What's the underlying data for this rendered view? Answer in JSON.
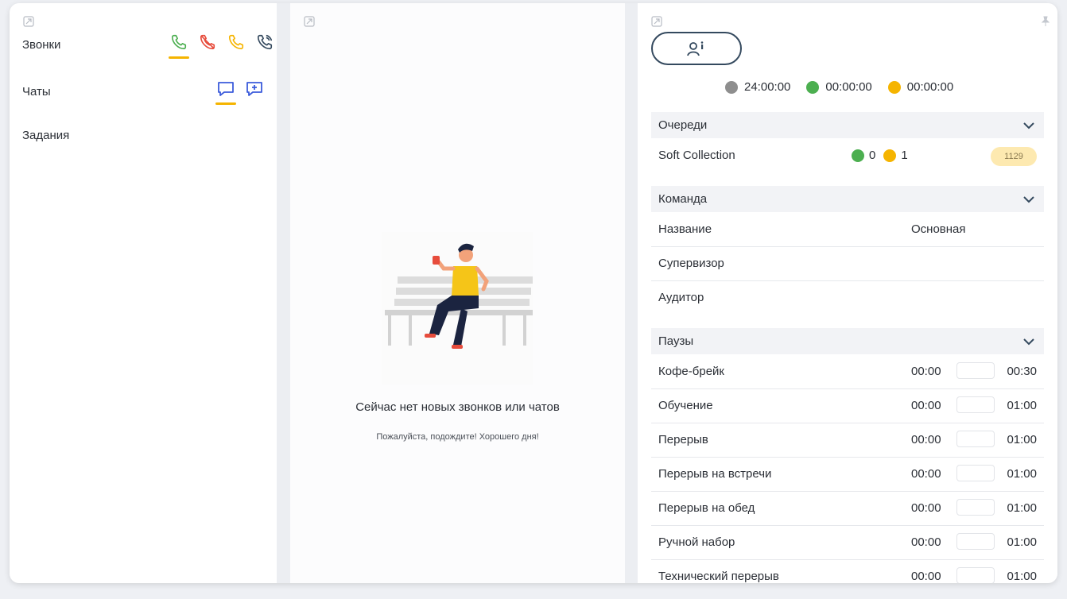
{
  "left": {
    "calls_label": "Звонки",
    "chats_label": "Чаты",
    "tasks_label": "Задания"
  },
  "middle": {
    "empty_title": "Сейчас нет новых звонков или чатов",
    "empty_subtitle": "Пожалуйста, подождите! Хорошего дня!"
  },
  "right": {
    "timers": [
      {
        "color": "#8e8e8e",
        "value": "24:00:00"
      },
      {
        "color": "#4caf50",
        "value": "00:00:00"
      },
      {
        "color": "#f5b400",
        "value": "00:00:00"
      }
    ],
    "queues": {
      "title": "Очереди",
      "items": [
        {
          "name": "Soft Collection",
          "green": "0",
          "yellow": "1",
          "badge": "1129"
        }
      ]
    },
    "team": {
      "title": "Команда",
      "rows": [
        {
          "label": "Название",
          "value": "Основная"
        },
        {
          "label": "Супервизор",
          "value": ""
        },
        {
          "label": "Аудитор",
          "value": ""
        }
      ]
    },
    "pauses": {
      "title": "Паузы",
      "items": [
        {
          "name": "Кофе-брейк",
          "start": "00:00",
          "end": "00:30"
        },
        {
          "name": "Обучение",
          "start": "00:00",
          "end": "01:00"
        },
        {
          "name": "Перерыв",
          "start": "00:00",
          "end": "01:00"
        },
        {
          "name": "Перерыв на встречи",
          "start": "00:00",
          "end": "01:00"
        },
        {
          "name": "Перерыв на обед",
          "start": "00:00",
          "end": "01:00"
        },
        {
          "name": "Ручной набор",
          "start": "00:00",
          "end": "01:00"
        },
        {
          "name": "Технический перерыв",
          "start": "00:00",
          "end": "01:00"
        }
      ]
    }
  }
}
